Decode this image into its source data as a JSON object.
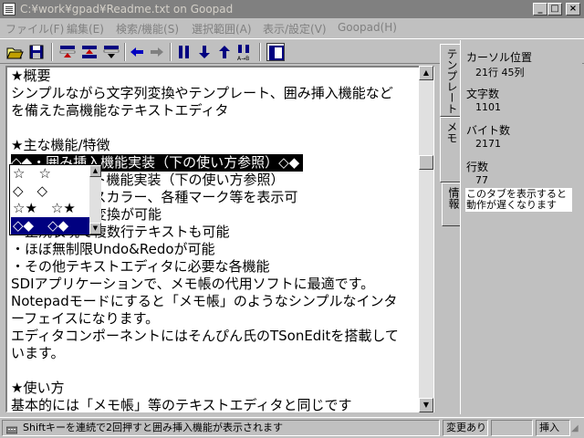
{
  "window": {
    "title": "C:¥work¥gpad¥Readme.txt on Goopad"
  },
  "menu": [
    {
      "label": "ファイル(F)"
    },
    {
      "label": "編集(E)"
    },
    {
      "label": "検索/機能(S)"
    },
    {
      "label": "選択範囲(A)"
    },
    {
      "label": "表示/設定(V)"
    },
    {
      "label": "Goopad(H)"
    }
  ],
  "toolbar": {
    "icons": [
      "open-folder-icon",
      "save-icon",
      "insert-top-icon",
      "insert-mid-icon",
      "insert-bottom-icon",
      "back-arrow-icon",
      "forward-arrow-icon",
      "bookmark-icon",
      "down-arrow-icon",
      "up-arrow-icon",
      "replace-icon",
      "panel-toggle-icon"
    ]
  },
  "editor": {
    "lines": [
      "★概要",
      "シンプルながら文字列変換やテンプレート、囲み挿入機能など",
      "を備えた高機能なテキストエディタ",
      "",
      "★主な機能/特徴",
      "◇◆・囲み挿入機能実装（下の使い方参照）◇◆",
      "・テンプレート機能実装（下の使い方参照）",
      "・シンタックスカラー、各種マーク等を表示可",
      "・各種文字列変換が可能",
      "・正規表現で複数行テキストも可能",
      "・ほぼ無制限Undo&Redoが可能",
      "・その他テキストエディタに必要な各機能",
      "SDIアプリケーションで、メモ帳の代用ソフトに最適です。",
      "Notepadモードにすると「メモ帳」のようなシンプルなインタ",
      "ーフェイスになります。",
      "エディタコンポーネントにはそんぴん氏のTSonEditを搭載して",
      "います。",
      "",
      "★使い方",
      "基本的には「メモ帳」等のテキストエディタと同じです",
      "他に以下のような機能があります"
    ],
    "selected_line_index": 5
  },
  "popup": {
    "items": [
      "☆　☆",
      "◇　◇",
      "☆★　☆★",
      "◇◆　◇◆"
    ],
    "selected_index": 3
  },
  "tabs": [
    {
      "label": "テンプレート"
    },
    {
      "label": "メモ"
    },
    {
      "label": "情報"
    }
  ],
  "panel": {
    "cursor_label": "カーソル位置",
    "cursor_value": "21行 45列",
    "chars_label": "文字数",
    "chars_value": "1101",
    "bytes_label": "バイト数",
    "bytes_value": "2171",
    "lines_label": "行数",
    "lines_value": "77",
    "note": "このタブを表示すると動作が遅くなります"
  },
  "status": {
    "message": "Shiftキーを連続で2回押すと囲み挿入機能が表示されます",
    "modified": "変更あり",
    "mode": "挿入"
  }
}
